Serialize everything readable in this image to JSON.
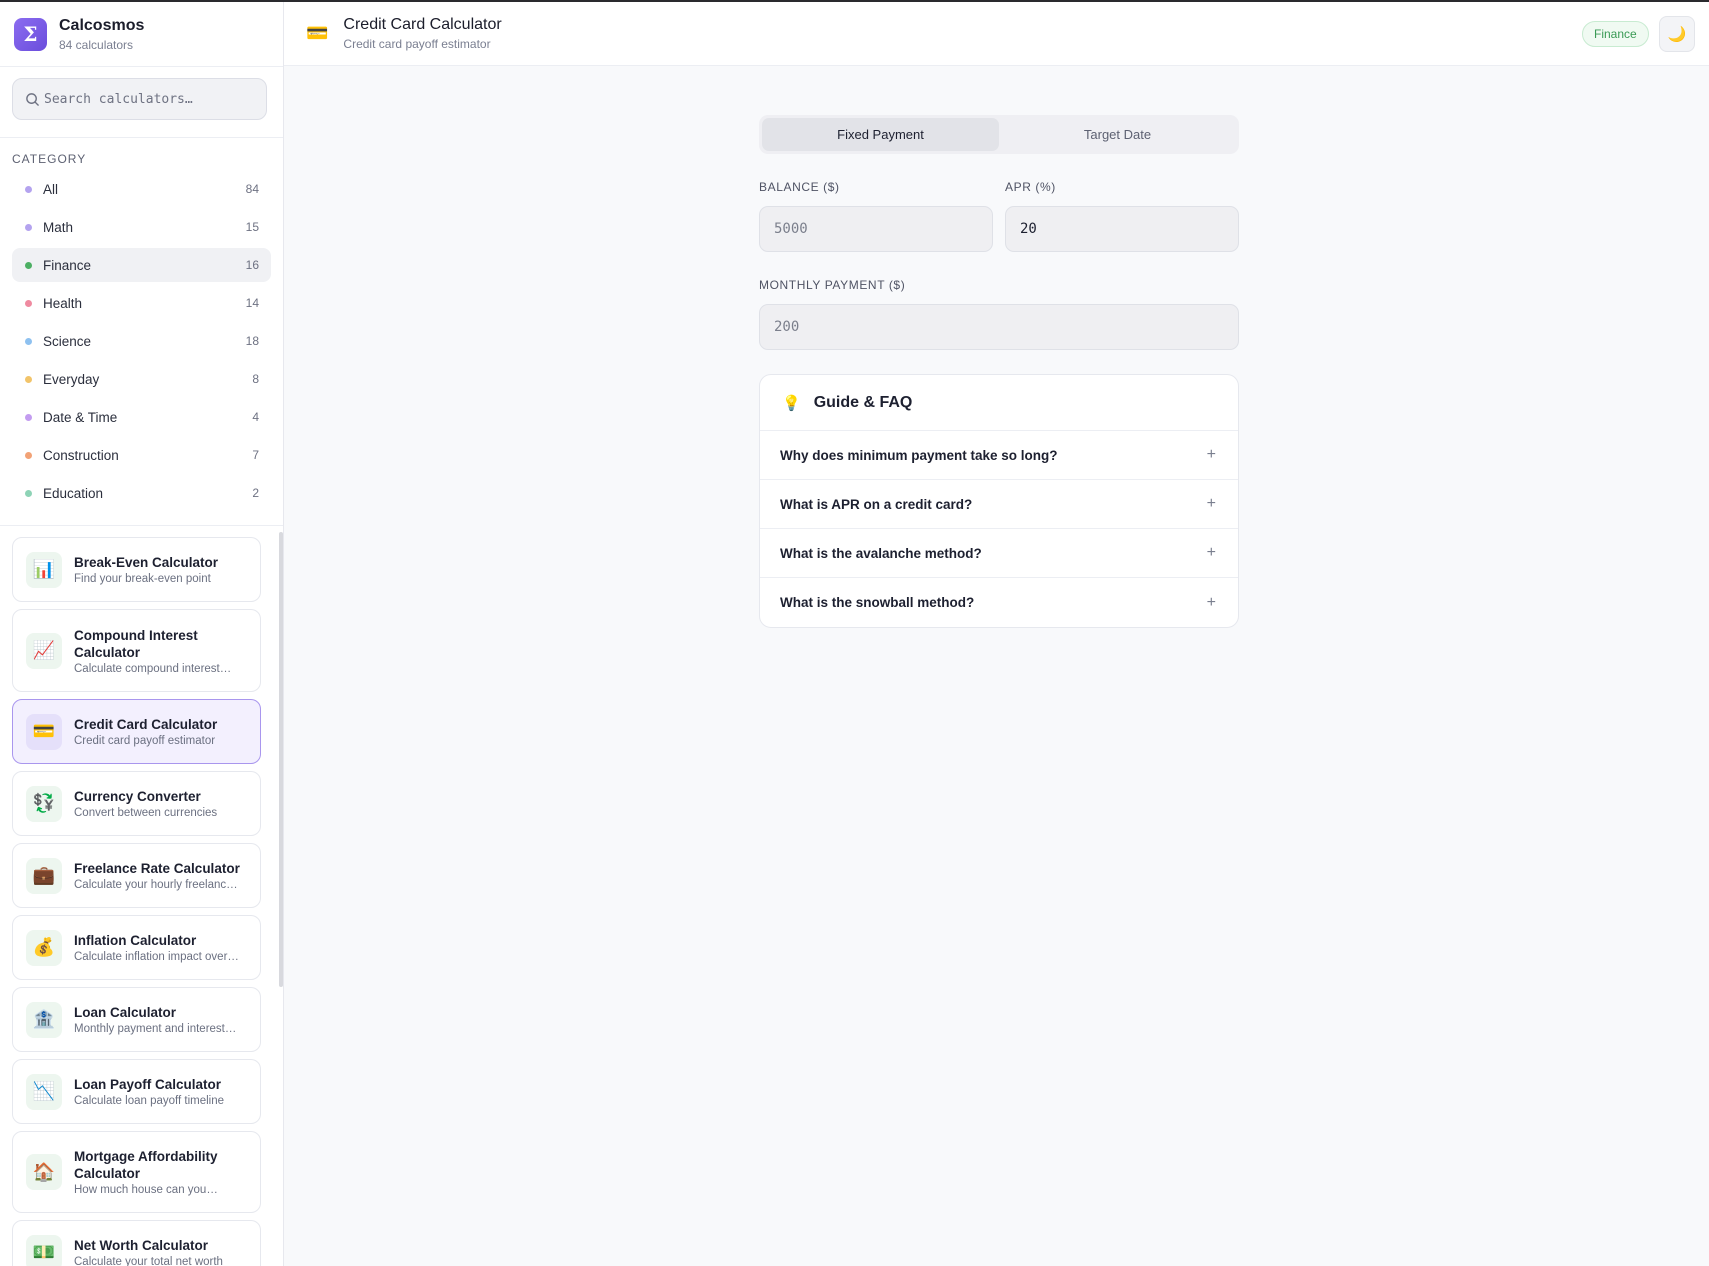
{
  "app": {
    "name": "Calcosmos",
    "count_text": "84 calculators",
    "logo_glyph": "Σ"
  },
  "search": {
    "placeholder": "Search calculators…"
  },
  "sidebar": {
    "category_title": "CATEGORY",
    "categories": [
      {
        "label": "All",
        "count": "84",
        "color": "#b4a3ef"
      },
      {
        "label": "Math",
        "count": "15",
        "color": "#b4a3ef"
      },
      {
        "label": "Finance",
        "count": "16",
        "color": "#4caf63"
      },
      {
        "label": "Health",
        "count": "14",
        "color": "#ef8aa0"
      },
      {
        "label": "Science",
        "count": "18",
        "color": "#8ec1f0"
      },
      {
        "label": "Everyday",
        "count": "8",
        "color": "#f2c46a"
      },
      {
        "label": "Date & Time",
        "count": "4",
        "color": "#c39cf0"
      },
      {
        "label": "Construction",
        "count": "7",
        "color": "#f2a276"
      },
      {
        "label": "Education",
        "count": "2",
        "color": "#8ed3b6"
      }
    ],
    "calculators": [
      {
        "title": "Break-Even Calculator",
        "desc": "Find your break-even point",
        "icon": "📊"
      },
      {
        "title": "Compound Interest Calculator",
        "desc": "Calculate compound interest…",
        "icon": "📈"
      },
      {
        "title": "Credit Card Calculator",
        "desc": "Credit card payoff estimator",
        "icon": "💳"
      },
      {
        "title": "Currency Converter",
        "desc": "Convert between currencies",
        "icon": "💱"
      },
      {
        "title": "Freelance Rate Calculator",
        "desc": "Calculate your hourly freelanc…",
        "icon": "💼"
      },
      {
        "title": "Inflation Calculator",
        "desc": "Calculate inflation impact over…",
        "icon": "💰"
      },
      {
        "title": "Loan Calculator",
        "desc": "Monthly payment and interest…",
        "icon": "🏦"
      },
      {
        "title": "Loan Payoff Calculator",
        "desc": "Calculate loan payoff timeline",
        "icon": "📉"
      },
      {
        "title": "Mortgage Affordability Calculator",
        "desc": "How much house can you…",
        "icon": "🏠"
      },
      {
        "title": "Net Worth Calculator",
        "desc": "Calculate your total net worth",
        "icon": "💵"
      }
    ]
  },
  "header": {
    "icon": "💳",
    "title": "Credit Card Calculator",
    "subtitle": "Credit card payoff estimator",
    "badge": "Finance",
    "theme_icon": "🌙"
  },
  "main": {
    "tabs": [
      {
        "label": "Fixed Payment"
      },
      {
        "label": "Target Date"
      }
    ],
    "fields": {
      "balance": {
        "label": "BALANCE ($)",
        "value": "5000"
      },
      "apr": {
        "label": "APR (%)",
        "value": "20"
      },
      "monthly": {
        "label": "MONTHLY PAYMENT ($)",
        "value": "200"
      }
    },
    "faq": {
      "icon": "💡",
      "title": "Guide & FAQ",
      "items": [
        {
          "q": "Why does minimum payment take so long?"
        },
        {
          "q": "What is APR on a credit card?"
        },
        {
          "q": "What is the avalanche method?"
        },
        {
          "q": "What is the snowball method?"
        }
      ],
      "expand_glyph": "+"
    }
  },
  "colors": {
    "accent": "#7c5ce8",
    "finance_green": "#3a9a55"
  }
}
